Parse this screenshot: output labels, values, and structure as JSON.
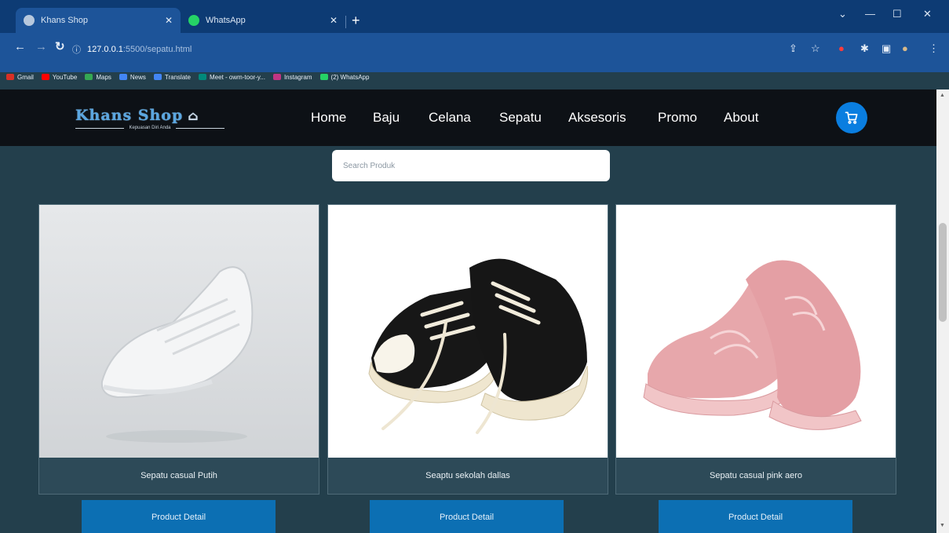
{
  "browser": {
    "tabs": [
      {
        "title": "Khans Shop",
        "active": true
      },
      {
        "title": "WhatsApp",
        "active": false
      }
    ],
    "url": {
      "host": "127.0.0.1",
      "path": ":5500/sepatu.html"
    },
    "bookmarks": [
      {
        "label": "Gmail",
        "color": "#d93025"
      },
      {
        "label": "YouTube",
        "color": "#ff0000"
      },
      {
        "label": "Maps",
        "color": "#34a853"
      },
      {
        "label": "News",
        "color": "#4285f4"
      },
      {
        "label": "Translate",
        "color": "#4285f4"
      },
      {
        "label": "Meet - owm-toor-y...",
        "color": "#00897b"
      },
      {
        "label": "Instagram",
        "color": "#c13584"
      },
      {
        "label": "(2) WhatsApp",
        "color": "#25d366"
      }
    ]
  },
  "site": {
    "logo": {
      "name": "Khans Shop",
      "tagline": "Kepuasan Diri Anda"
    },
    "nav": [
      "Home",
      "Baju",
      "Celana",
      "Sepatu",
      "Aksesoris",
      "Promo",
      "About"
    ],
    "search_placeholder": "Search Produk",
    "products": [
      {
        "name": "Sepatu casual Putih",
        "button": "Product Detail"
      },
      {
        "name": "Seaptu sekolah dallas",
        "button": "Product Detail"
      },
      {
        "name": "Sepatu casual pink aero",
        "button": "Product Detail"
      }
    ]
  },
  "colors": {
    "page_bg": "#233f4c",
    "header_bg": "#0d1116",
    "accent": "#0a7ee0",
    "button": "#0c6fb3",
    "chrome": "#1d5499"
  }
}
